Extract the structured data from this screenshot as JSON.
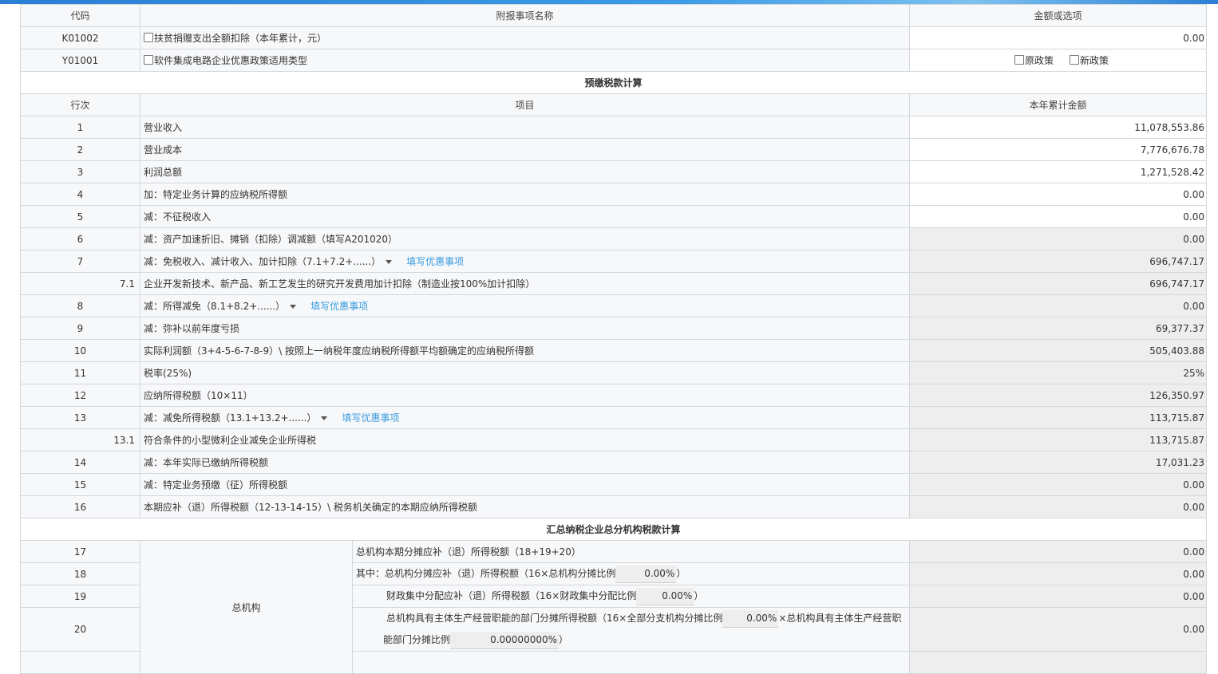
{
  "extra_table": {
    "headers": {
      "code": "代码",
      "name": "附报事项名称",
      "value": "金额或选项"
    },
    "rows": [
      {
        "code": "K01002",
        "name": "扶贫捐赠支出全额扣除（本年累计，元）",
        "value": "0.00"
      },
      {
        "code": "Y01001",
        "name": "软件集成电路企业优惠政策适用类型",
        "options": [
          "原政策",
          "新政策"
        ]
      }
    ]
  },
  "prepay_section": {
    "title": "预缴税款计算",
    "headers": {
      "row": "行次",
      "item": "项目",
      "amount": "本年累计金额"
    },
    "link_label": "填写优惠事项",
    "rows": [
      {
        "no": "1",
        "item": "营业收入",
        "amount": "11,078,553.86"
      },
      {
        "no": "2",
        "item": "营业成本",
        "amount": "7,776,676.78"
      },
      {
        "no": "3",
        "item": "利润总额",
        "amount": "1,271,528.42"
      },
      {
        "no": "4",
        "item": "加：特定业务计算的应纳税所得额",
        "amount": "0.00"
      },
      {
        "no": "5",
        "item": "减：不征税收入",
        "amount": "0.00"
      },
      {
        "no": "6",
        "item": "减：资产加速折旧、摊销（扣除）调减额（填写A201020）",
        "amount": "0.00"
      },
      {
        "no": "7",
        "item": "减：免税收入、减计收入、加计扣除（7.1+7.2+......）",
        "amount": "696,747.17"
      },
      {
        "no": "7.1",
        "item": "企业开发新技术、新产品、新工艺发生的研究开发费用加计扣除（制造业按100%加计扣除）",
        "amount": "696,747.17"
      },
      {
        "no": "8",
        "item": "减：所得减免（8.1+8.2+......）",
        "amount": "0.00"
      },
      {
        "no": "9",
        "item": "减：弥补以前年度亏损",
        "amount": "69,377.37"
      },
      {
        "no": "10",
        "item": "实际利润额（3+4-5-6-7-8-9）\\ 按照上一纳税年度应纳税所得额平均额确定的应纳税所得额",
        "amount": "505,403.88"
      },
      {
        "no": "11",
        "item": "税率(25%)",
        "amount": "25%"
      },
      {
        "no": "12",
        "item": "应纳所得税额（10×11）",
        "amount": "126,350.97"
      },
      {
        "no": "13",
        "item": "减：减免所得税额（13.1+13.2+......）",
        "amount": "113,715.87"
      },
      {
        "no": "13.1",
        "item": "符合条件的小型微利企业减免企业所得税",
        "amount": "113,715.87"
      },
      {
        "no": "14",
        "item": "减：本年实际已缴纳所得税额",
        "amount": "17,031.23"
      },
      {
        "no": "15",
        "item": "减：特定业务预缴（征）所得税额",
        "amount": "0.00"
      },
      {
        "no": "16",
        "item": "本期应补（退）所得税额（12-13-14-15）\\ 税务机关确定的本期应纳所得税额",
        "amount": "0.00"
      }
    ]
  },
  "branch_section": {
    "title": "汇总纳税企业总分机构税款计算",
    "org_label": "总机构",
    "rows": [
      {
        "no": "17",
        "item": "总机构本期分摊应补（退）所得税额（18+19+20）",
        "amount": "0.00"
      },
      {
        "no": "18",
        "item": "其中：总机构分摊应补（退）所得税额（16×总机构分摊比例",
        "ratio": "0.00%",
        "suffix": "）",
        "amount": "0.00"
      },
      {
        "no": "19",
        "item": "财政集中分配应补（退）所得税额（16×财政集中分配比例",
        "ratio": "0.00%",
        "suffix": "）",
        "amount": "0.00"
      },
      {
        "no": "20",
        "item": "总机构具有主体生产经营职能的部门分摊所得税额（16×全部分支机构分摊比例",
        "ratio": "0.00%",
        "item_mid": "×总机构具有主体生产经营职",
        "item_line2": "能部门分摊比例",
        "ratio2": "0.00000000%",
        "suffix": "）",
        "amount": "0.00"
      }
    ]
  }
}
